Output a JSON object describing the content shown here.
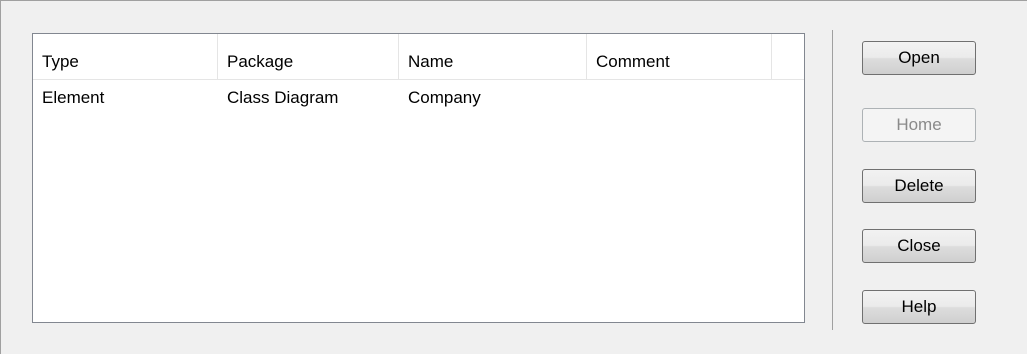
{
  "list": {
    "columns": [
      "Type",
      "Package",
      "Name",
      "Comment"
    ],
    "rows": [
      {
        "type": "Element",
        "package": "Class Diagram",
        "name": "Company",
        "comment": ""
      }
    ]
  },
  "buttons": {
    "open": "Open",
    "home": "Home",
    "delete": "Delete",
    "close": "Close",
    "help": "Help"
  }
}
